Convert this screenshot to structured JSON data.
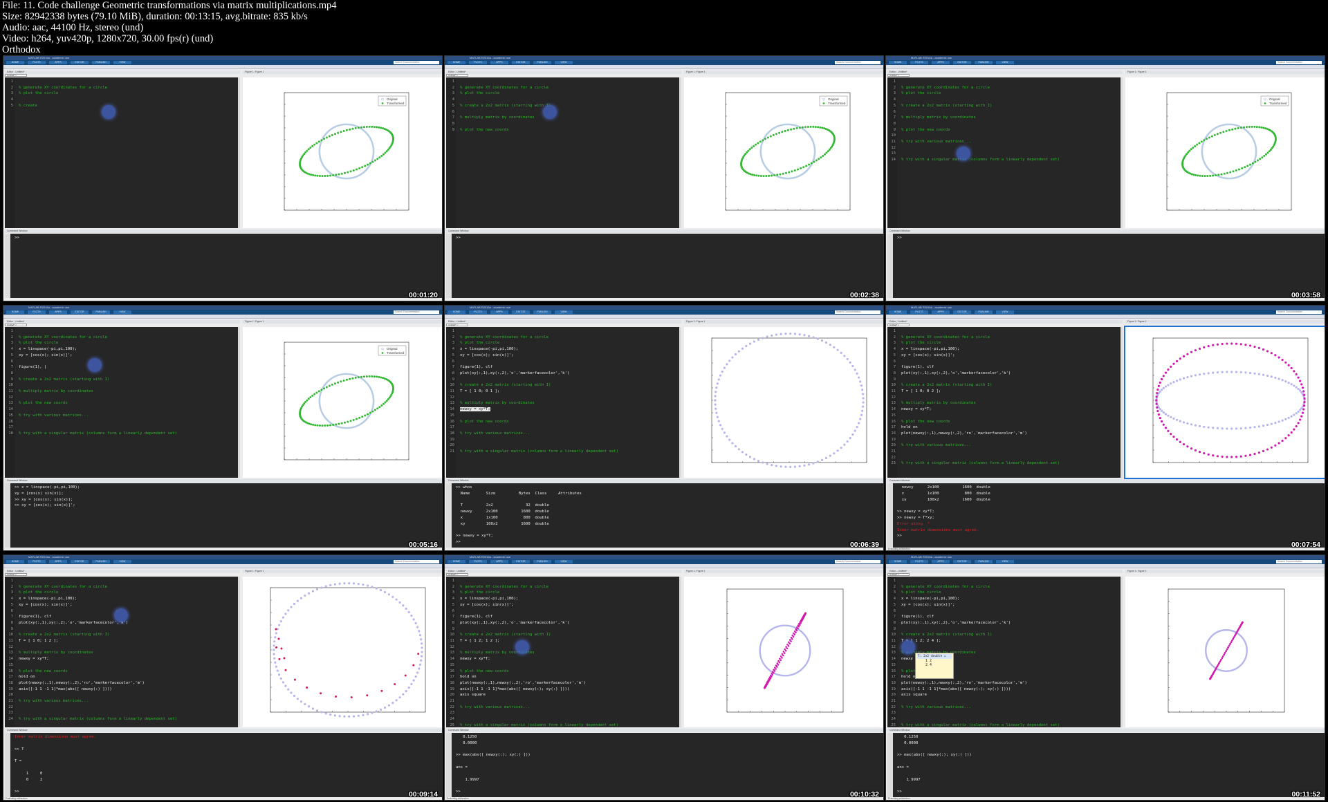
{
  "header": {
    "lines": [
      "File: 11. Code challenge Geometric transformations via matrix multiplications.mp4",
      "Size: 82942338 bytes (79.10 MiB), duration: 00:13:15, avg.bitrate: 835 kb/s",
      "Audio: aac, 44100 Hz, stereo (und)",
      "Video: h264, yuv420p, 1280x720, 30.00 fps(r) (und)",
      "Orthodox"
    ]
  },
  "tiles": [
    {
      "timestamp": "00:01:20",
      "code": [
        {
          "t": "",
          "c": "cm"
        },
        {
          "t": "% generate XY coordinates for a circle",
          "c": "cm"
        },
        {
          "t": "% plot the circle",
          "c": "cm"
        },
        {
          "t": "",
          "c": ""
        },
        {
          "t": "% create",
          "c": "cm"
        }
      ],
      "bubble": [
        140,
        40
      ],
      "plot": "circle_green",
      "cw": [
        {
          "t": ">>",
          "c": ""
        }
      ]
    },
    {
      "timestamp": "00:02:38",
      "code": [
        {
          "t": "",
          "c": "cm"
        },
        {
          "t": "% generate XY coordinates for a circle",
          "c": "cm"
        },
        {
          "t": "% plot the circle",
          "c": "cm"
        },
        {
          "t": "",
          "c": ""
        },
        {
          "t": "% create a 2x2 matrix (starting with I)",
          "c": "cm"
        },
        {
          "t": "",
          "c": ""
        },
        {
          "t": "% multiply matrix by coordinates",
          "c": "cm"
        },
        {
          "t": "",
          "c": ""
        },
        {
          "t": "% plot the new coords",
          "c": "cm"
        }
      ],
      "bubble": [
        140,
        40
      ],
      "plot": "circle_green",
      "cw": [
        {
          "t": ">>",
          "c": ""
        }
      ]
    },
    {
      "timestamp": "00:03:58",
      "code": [
        {
          "t": "",
          "c": "cm"
        },
        {
          "t": "% generate XY coordinates for a circle",
          "c": "cm"
        },
        {
          "t": "% plot the circle",
          "c": "cm"
        },
        {
          "t": "",
          "c": ""
        },
        {
          "t": "% create a 2x2 matrix (starting with I)",
          "c": "cm"
        },
        {
          "t": "",
          "c": ""
        },
        {
          "t": "% multiply matrix by coordinates",
          "c": "cm"
        },
        {
          "t": "",
          "c": ""
        },
        {
          "t": "% plot the new coords",
          "c": "cm"
        },
        {
          "t": "",
          "c": ""
        },
        {
          "t": "% try with various matrices...",
          "c": "cm"
        },
        {
          "t": "",
          "c": ""
        },
        {
          "t": "",
          "c": ""
        },
        {
          "t": "% try with a singular matrix (columns form a linearly dependent set)",
          "c": "cm"
        }
      ],
      "bubble": [
        100,
        100
      ],
      "plot": "circle_green",
      "cw": [
        {
          "t": ">>",
          "c": ""
        }
      ]
    },
    {
      "timestamp": "00:05:16",
      "code": [
        {
          "t": "",
          "c": "cm"
        },
        {
          "t": "% generate XY coordinates for a circle",
          "c": "cm"
        },
        {
          "t": "% plot the circle",
          "c": "cm"
        },
        {
          "t": "x = linspace(-pi,pi,100);",
          "c": ""
        },
        {
          "t": "xy = [cos(x); sin(x)]';",
          "c": ""
        },
        {
          "t": "",
          "c": ""
        },
        {
          "t": "figure(1), |",
          "c": ""
        },
        {
          "t": "",
          "c": ""
        },
        {
          "t": "% create a 2x2 matrix (starting with I)",
          "c": "cm"
        },
        {
          "t": "",
          "c": ""
        },
        {
          "t": "% multiply matrix by coordinates",
          "c": "cm"
        },
        {
          "t": "",
          "c": ""
        },
        {
          "t": "% plot the new coords",
          "c": "cm"
        },
        {
          "t": "",
          "c": ""
        },
        {
          "t": "% try with various matrices...",
          "c": "cm"
        },
        {
          "t": "",
          "c": ""
        },
        {
          "t": "",
          "c": ""
        },
        {
          "t": "% try with a singular matrix (columns form a linearly dependent set)",
          "c": "cm"
        }
      ],
      "bubble": [
        120,
        45
      ],
      "plot": "circle_green",
      "cw": [
        {
          "t": ">> x = linspace(-pi,pi,100);",
          "c": ""
        },
        {
          "t": "xy = [cos(x) sin(x)];",
          "c": ""
        },
        {
          "t": ">> xy = [cos(x); sin(x)];",
          "c": ""
        },
        {
          "t": ">> xy = [cos(x); sin(x)]';",
          "c": ""
        }
      ]
    },
    {
      "timestamp": "00:06:39",
      "code": [
        {
          "t": "",
          "c": "cm"
        },
        {
          "t": "% generate XY coordinates for a circle",
          "c": "cm"
        },
        {
          "t": "% plot the circle",
          "c": "cm"
        },
        {
          "t": "x = linspace(-pi,pi,100);",
          "c": ""
        },
        {
          "t": "xy = [cos(x); sin(x)]';",
          "c": ""
        },
        {
          "t": "",
          "c": ""
        },
        {
          "t": "figure(1), clf",
          "c": ""
        },
        {
          "t": "plot(xy(:,1),xy(:,2),'o','markerfacecolor','k')",
          "c": ""
        },
        {
          "t": "",
          "c": ""
        },
        {
          "t": "% create a 2x2 matrix (starting with I)",
          "c": "cm"
        },
        {
          "t": "T = [ 1 0; 0 1 ];",
          "c": ""
        },
        {
          "t": "",
          "c": ""
        },
        {
          "t": "% multiply matrix by coordinates",
          "c": "cm"
        },
        {
          "t": "newxy = xy*T;",
          "c": "hl"
        },
        {
          "t": "",
          "c": ""
        },
        {
          "t": "% plot the new coords",
          "c": "cm"
        },
        {
          "t": "",
          "c": ""
        },
        {
          "t": "% try with various matrices...",
          "c": "cm"
        },
        {
          "t": "",
          "c": ""
        },
        {
          "t": "",
          "c": ""
        },
        {
          "t": "% try with a singular matrix (columns form a linearly dependent set)",
          "c": "cm"
        }
      ],
      "bubble": [
        -100,
        -100
      ],
      "plot": "circle_only",
      "cw": [
        {
          "t": ">> whos",
          "c": ""
        },
        {
          "t": "  Name       Size          Bytes  Class     Attributes",
          "c": ""
        },
        {
          "t": "",
          "c": ""
        },
        {
          "t": "  T          2x2              32  double",
          "c": ""
        },
        {
          "t": "  newxy      2x100          1600  double",
          "c": ""
        },
        {
          "t": "  x          1x100           800  double",
          "c": ""
        },
        {
          "t": "  xy         100x2          1600  double",
          "c": ""
        },
        {
          "t": "",
          "c": ""
        },
        {
          "t": ">> newxy = xy*T;",
          "c": ""
        },
        {
          "t": ">>",
          "c": ""
        }
      ]
    },
    {
      "timestamp": "00:07:54",
      "code": [
        {
          "t": "",
          "c": "cm"
        },
        {
          "t": "% generate XY coordinates for a circle",
          "c": "cm"
        },
        {
          "t": "% plot the circle",
          "c": "cm"
        },
        {
          "t": "x = linspace(-pi,pi,100);",
          "c": ""
        },
        {
          "t": "xy = [cos(x); sin(x)]';",
          "c": ""
        },
        {
          "t": "",
          "c": ""
        },
        {
          "t": "figure(1), clf",
          "c": ""
        },
        {
          "t": "plot(xy(:,1),xy(:,2),'o','markerfacecolor','k')",
          "c": ""
        },
        {
          "t": "",
          "c": ""
        },
        {
          "t": "% create a 2x2 matrix (starting with I)",
          "c": "cm"
        },
        {
          "t": "T = [ 1 0; 0 2 ];",
          "c": ""
        },
        {
          "t": "",
          "c": ""
        },
        {
          "t": "% multiply matrix by coordinates",
          "c": "cm"
        },
        {
          "t": "newxy = xy*T;",
          "c": ""
        },
        {
          "t": "",
          "c": ""
        },
        {
          "t": "% plot the new coords",
          "c": "cm"
        },
        {
          "t": "hold on",
          "c": ""
        },
        {
          "t": "plot(newxy(:,1),newxy(:,2),'ro','markerfacecolor','m')",
          "c": ""
        },
        {
          "t": "",
          "c": ""
        },
        {
          "t": "% try with various matrices...",
          "c": "cm"
        },
        {
          "t": "",
          "c": ""
        },
        {
          "t": "",
          "c": ""
        },
        {
          "t": "% try with a singular matrix (columns form a linearly dependent set)",
          "c": "cm"
        }
      ],
      "bubble": [
        -100,
        -100
      ],
      "plot": "ellipse_v",
      "cw": [
        {
          "t": "  newxy      2x100          1600  double",
          "c": ""
        },
        {
          "t": "  x          1x100           800  double",
          "c": ""
        },
        {
          "t": "  xy         100x2          1600  double",
          "c": ""
        },
        {
          "t": "",
          "c": ""
        },
        {
          "t": ">> newxy = xy*T;",
          "c": ""
        },
        {
          "t": ">> newxy = T*xy;",
          "c": ""
        },
        {
          "t": "Error using  *",
          "c": "err"
        },
        {
          "t": "Inner matrix dimensions must agree.",
          "c": "err"
        },
        {
          "t": ">>",
          "c": ""
        }
      ]
    },
    {
      "timestamp": "00:09:14",
      "code": [
        {
          "t": "",
          "c": "cm"
        },
        {
          "t": "% generate XY coordinates for a circle",
          "c": "cm"
        },
        {
          "t": "% plot the circle",
          "c": "cm"
        },
        {
          "t": "x = linspace(-pi,pi,100);",
          "c": ""
        },
        {
          "t": "xy = [cos(x); sin(x)]';",
          "c": ""
        },
        {
          "t": "",
          "c": ""
        },
        {
          "t": "figure(1), clf",
          "c": ""
        },
        {
          "t": "plot(xy(:,1),xy(:,2),'o','markerfacecolor','k')",
          "c": ""
        },
        {
          "t": "",
          "c": ""
        },
        {
          "t": "% create a 2x2 matrix (starting with I)",
          "c": "cm"
        },
        {
          "t": "T = [ 1 0; 1 2 ];",
          "c": ""
        },
        {
          "t": "",
          "c": ""
        },
        {
          "t": "% multiply matrix by coordinates",
          "c": "cm"
        },
        {
          "t": "newxy = xy*T;",
          "c": ""
        },
        {
          "t": "",
          "c": ""
        },
        {
          "t": "% plot the new coords",
          "c": "cm"
        },
        {
          "t": "hold on",
          "c": ""
        },
        {
          "t": "plot(newxy(:,1),newxy(:,2),'ro','markerfacecolor','m')",
          "c": ""
        },
        {
          "t": "axis([-1 1 -1 1]*max(abs([ newxy(:) ])))",
          "c": ""
        },
        {
          "t": "",
          "c": ""
        },
        {
          "t": "% try with various matrices...",
          "c": "cm"
        },
        {
          "t": "",
          "c": ""
        },
        {
          "t": "",
          "c": ""
        },
        {
          "t": "% try with a singular matrix (columns form a linearly dependent set)",
          "c": "cm"
        }
      ],
      "bubble": [
        158,
        46
      ],
      "plot": "partial",
      "cw": [
        {
          "t": "Inner matrix dimensions must agree.",
          "c": "err"
        },
        {
          "t": "",
          "c": ""
        },
        {
          "t": ">> T",
          "c": ""
        },
        {
          "t": "",
          "c": ""
        },
        {
          "t": "T =",
          "c": ""
        },
        {
          "t": "",
          "c": ""
        },
        {
          "t": "     1     0",
          "c": ""
        },
        {
          "t": "     0     2",
          "c": ""
        },
        {
          "t": "",
          "c": ""
        },
        {
          "t": ">>",
          "c": ""
        }
      ]
    },
    {
      "timestamp": "00:10:32",
      "code": [
        {
          "t": "",
          "c": "cm"
        },
        {
          "t": "% generate XY coordinates for a circle",
          "c": "cm"
        },
        {
          "t": "% plot the circle",
          "c": "cm"
        },
        {
          "t": "x = linspace(-pi,pi,100);",
          "c": ""
        },
        {
          "t": "xy = [cos(x); sin(x)]';",
          "c": ""
        },
        {
          "t": "",
          "c": ""
        },
        {
          "t": "figure(1), clf",
          "c": ""
        },
        {
          "t": "plot(xy(:,1),xy(:,2),'o','markerfacecolor','k')",
          "c": ""
        },
        {
          "t": "",
          "c": ""
        },
        {
          "t": "% create a 2x2 matrix (starting with I)",
          "c": "cm"
        },
        {
          "t": "T = [ 1 2; 1 2 ];",
          "c": ""
        },
        {
          "t": "",
          "c": ""
        },
        {
          "t": "% multiply matrix by coordinates",
          "c": "cm"
        },
        {
          "t": "newxy = xy*T;",
          "c": ""
        },
        {
          "t": "",
          "c": ""
        },
        {
          "t": "% plot the new coords",
          "c": "cm"
        },
        {
          "t": "hold on",
          "c": ""
        },
        {
          "t": "plot(newxy(:,1),newxy(:,2),'ro','markerfacecolor','m')",
          "c": ""
        },
        {
          "t": "axis([-1 1 -1 1]*max(abs([ newxy(:); xy(:) ])))",
          "c": ""
        },
        {
          "t": "axis square",
          "c": ""
        },
        {
          "t": "",
          "c": ""
        },
        {
          "t": "% try with various matrices...",
          "c": "cm"
        },
        {
          "t": "",
          "c": ""
        },
        {
          "t": "",
          "c": ""
        },
        {
          "t": "% try with a singular matrix (columns form a linearly dependent set)",
          "c": "cm"
        }
      ],
      "bubble": [
        100,
        92
      ],
      "plot": "line_loop",
      "cw": [
        {
          "t": "   0.1250",
          "c": ""
        },
        {
          "t": "   0.0000",
          "c": ""
        },
        {
          "t": "",
          "c": ""
        },
        {
          "t": ">> max(abs([ newxy(:); xy(:) ]))",
          "c": ""
        },
        {
          "t": "",
          "c": ""
        },
        {
          "t": "ans =",
          "c": ""
        },
        {
          "t": "",
          "c": ""
        },
        {
          "t": "    1.9997",
          "c": ""
        },
        {
          "t": "",
          "c": ""
        },
        {
          "t": ">>",
          "c": ""
        }
      ]
    },
    {
      "timestamp": "00:11:52",
      "code": [
        {
          "t": "",
          "c": "cm"
        },
        {
          "t": "% generate XY coordinates for a circle",
          "c": "cm"
        },
        {
          "t": "% plot the circle",
          "c": "cm"
        },
        {
          "t": "x = linspace(-pi,pi,100);",
          "c": ""
        },
        {
          "t": "xy = [cos(x); sin(x)]';",
          "c": ""
        },
        {
          "t": "",
          "c": ""
        },
        {
          "t": "figure(1), clf",
          "c": ""
        },
        {
          "t": "plot(xy(:,1),xy(:,2),'o','markerfacecolor','k')",
          "c": ""
        },
        {
          "t": "",
          "c": ""
        },
        {
          "t": "% create a 2x2 matrix (starting with I)",
          "c": "cm"
        },
        {
          "t": "T = [ 1 2; 2 4 ];",
          "c": ""
        },
        {
          "t": "",
          "c": ""
        },
        {
          "t": "% multiply matrix by coordinates",
          "c": "cm"
        },
        {
          "t": "newxy = xy*T;",
          "c": ""
        },
        {
          "t": "",
          "c": ""
        },
        {
          "t": "% plot the new coords",
          "c": "cm"
        },
        {
          "t": "hold on",
          "c": ""
        },
        {
          "t": "plot(newxy(:,1),newxy(:,2),'ro','markerfacecolor','m')",
          "c": ""
        },
        {
          "t": "axis([-1 1 -1 1]*max(abs([ newxy(:); xy(:) ])))",
          "c": ""
        },
        {
          "t": "axis square",
          "c": ""
        },
        {
          "t": "",
          "c": ""
        },
        {
          "t": "% try with various matrices...",
          "c": "cm"
        },
        {
          "t": "",
          "c": ""
        },
        {
          "t": "",
          "c": ""
        },
        {
          "t": "% try with a singular matrix (columns form a linearly dependent set)",
          "c": "cm"
        }
      ],
      "bubble": [
        20,
        92
      ],
      "plot": "line_thin",
      "tooltip": {
        "title": "T: 2x2 double =",
        "rows": [
          "1     2",
          "2     4"
        ]
      },
      "cw": [
        {
          "t": "   0.1250",
          "c": ""
        },
        {
          "t": "   0.0000",
          "c": ""
        },
        {
          "t": "",
          "c": ""
        },
        {
          "t": ">> max(abs([ newxy(:); xy(:) ]))",
          "c": ""
        },
        {
          "t": "",
          "c": ""
        },
        {
          "t": "ans =",
          "c": ""
        },
        {
          "t": "",
          "c": ""
        },
        {
          "t": "    1.9997",
          "c": ""
        },
        {
          "t": "",
          "c": ""
        },
        {
          "t": ">>",
          "c": ""
        }
      ]
    }
  ],
  "chrome": {
    "window_title": "MATLAB R2016a - academic use",
    "ribbon_tabs": [
      "HOME",
      "PLOTS",
      "APPS",
      "EDITOR",
      "PUBLISH",
      "VIEW"
    ],
    "search_placeholder": "Search Documentation",
    "editor_title": "Editor - Untitled*",
    "editor_tab": "Untitled* ×",
    "figure_title": "Figure 1: Figure 1",
    "cw_title": "Command Window",
    "status_text": "Evaluating cell/section"
  },
  "legend": {
    "original": "Original",
    "transformed": "Transformed"
  },
  "colors": {
    "circle": "#b7cde4",
    "green": "#33b833",
    "lavender": "#b7b6ec",
    "magenta": "#d11bb0"
  }
}
